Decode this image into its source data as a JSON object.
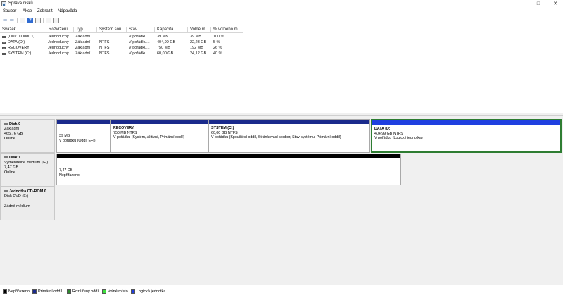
{
  "window": {
    "title": "Správa disků",
    "min": "—",
    "max": "□",
    "close": "✕"
  },
  "menu": [
    "Soubor",
    "Akce",
    "Zobrazit",
    "Nápověda"
  ],
  "table": {
    "headers": [
      "Svazek",
      "Rozvržení",
      "Typ",
      "Systém sou...",
      "Stav",
      "Kapacita",
      "Volné m...",
      "% volného m..."
    ],
    "rows": [
      [
        "(Disk 0 Oddíl 1)",
        "Jednoduchý",
        "Základní",
        "",
        "V pořádku...",
        "39 MB",
        "39 MB",
        "100 %"
      ],
      [
        "DATA (D:)",
        "Jednoduchý",
        "Základní",
        "NTFS",
        "V pořádku...",
        "404,99 GB",
        "22,23 GB",
        "5 %"
      ],
      [
        "RECOVERY",
        "Jednoduchý",
        "Základní",
        "NTFS",
        "V pořádku...",
        "750 MB",
        "192 MB",
        "26 %"
      ],
      [
        "SYSTEM (C:)",
        "Jednoduchý",
        "Základní",
        "NTFS",
        "V pořádku...",
        "60,00 GB",
        "24,12 GB",
        "40 %"
      ]
    ]
  },
  "disks": [
    {
      "name": "Disk 0",
      "type": "Základní",
      "size": "465,76 GB",
      "status": "Online",
      "partitions": [
        {
          "title": "",
          "size": "39 MB",
          "status": "V pořádku (Oddíl EFI)"
        },
        {
          "title": "RECOVERY",
          "size": "750 MB NTFS",
          "status": "V pořádku (Systém, Aktivní, Primární oddíl)"
        },
        {
          "title": "SYSTEM  (C:)",
          "size": "60,00 GB NTFS",
          "status": "V pořádku (Spouštěcí oddíl, Stránkovací soubor, Stav systému, Primární oddíl)"
        },
        {
          "title": "DATA  (D:)",
          "size": "404,99 GB NTFS",
          "status": "V pořádku (Logický jednotka)"
        }
      ]
    },
    {
      "name": "Disk 1",
      "type": "Vyměnitelné médium (G:)",
      "size": "7,47 GB",
      "status": "Online",
      "partitions": [
        {
          "size": "7,47 GB",
          "status": "Nepřiřazeno"
        }
      ]
    },
    {
      "name": "Jednotka CD-ROM 0",
      "type": "Disk DVD (E:)",
      "size": "",
      "status": "Žádné médium"
    }
  ],
  "legend": [
    {
      "label": "Nepřiřazeno",
      "color": "#000000"
    },
    {
      "label": "Primární oddíl",
      "color": "#1a2a8c"
    },
    {
      "label": "Rozšířený oddíl",
      "color": "#2e8b2e"
    },
    {
      "label": "Volné místo",
      "color": "#3ce03c"
    },
    {
      "label": "Logická jednotka",
      "color": "#1f3fe0"
    }
  ],
  "colors": {
    "primary_band": "#1a2a8c",
    "logical_band": "#1f3fe0",
    "unallocated_band": "#000000",
    "selected_border": "#2e7d32"
  },
  "icons": [
    "back-arrow-icon",
    "forward-arrow-icon",
    "properties-icon",
    "help-icon",
    "rescan-icon",
    "disk-icon",
    "cdrom-icon"
  ]
}
